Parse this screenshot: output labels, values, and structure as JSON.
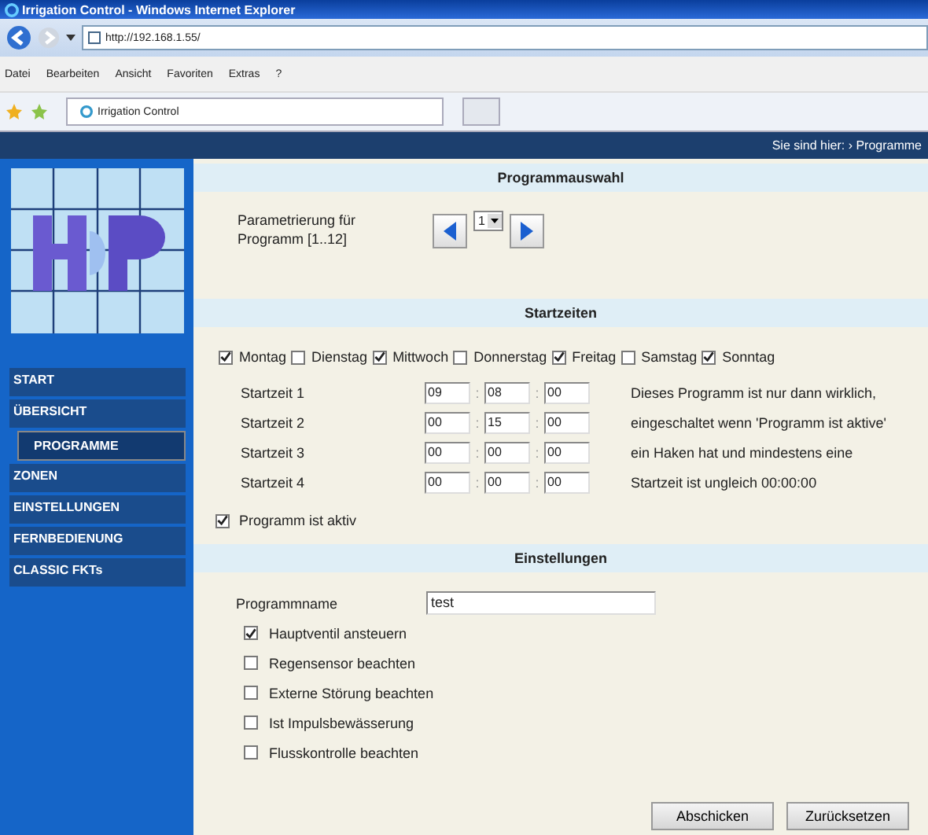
{
  "window": {
    "title": "Irrigation Control - Windows Internet Explorer"
  },
  "address_bar": {
    "url": "http://192.168.1.55/"
  },
  "menu": [
    "Datei",
    "Bearbeiten",
    "Ansicht",
    "Favoriten",
    "Extras",
    "?"
  ],
  "tab": {
    "label": "Irrigation Control"
  },
  "breadcrumb": {
    "label": "Sie sind hier:",
    "arrow": "›",
    "current": "Programme"
  },
  "sidebar": {
    "items": [
      {
        "label": "START",
        "selected": false,
        "sub": false
      },
      {
        "label": "ÜBERSICHT",
        "selected": false,
        "sub": false
      },
      {
        "label": "PROGRAMME",
        "selected": true,
        "sub": true
      },
      {
        "label": "ZONEN",
        "selected": false,
        "sub": false
      },
      {
        "label": "EINSTELLUNGEN",
        "selected": false,
        "sub": false
      },
      {
        "label": "FERNBEDIENUNG",
        "selected": false,
        "sub": false
      },
      {
        "label": "CLASSIC FKTs",
        "selected": false,
        "sub": false
      }
    ]
  },
  "program_selection": {
    "heading": "Programmauswahl",
    "label": "Parametrierung für Programm [1..12]",
    "value": "1"
  },
  "start_times": {
    "heading": "Startzeiten",
    "days": [
      {
        "label": "Montag",
        "checked": true
      },
      {
        "label": "Dienstag",
        "checked": false
      },
      {
        "label": "Mittwoch",
        "checked": true
      },
      {
        "label": "Donnerstag",
        "checked": false
      },
      {
        "label": "Freitag",
        "checked": true
      },
      {
        "label": "Samstag",
        "checked": false
      },
      {
        "label": "Sonntag",
        "checked": true
      }
    ],
    "rows": [
      {
        "label": "Startzeit 1",
        "h": "09",
        "m": "08",
        "s": "00",
        "note": "Dieses Programm ist nur dann wirklich,"
      },
      {
        "label": "Startzeit 2",
        "h": "00",
        "m": "15",
        "s": "00",
        "note": "eingeschaltet wenn 'Programm ist aktive'"
      },
      {
        "label": "Startzeit 3",
        "h": "00",
        "m": "00",
        "s": "00",
        "note": "ein Haken hat und mindestens eine"
      },
      {
        "label": "Startzeit 4",
        "h": "00",
        "m": "00",
        "s": "00",
        "note": "Startzeit ist ungleich 00:00:00"
      }
    ],
    "separator": ":",
    "active": {
      "label": "Programm ist aktiv",
      "checked": true
    }
  },
  "settings": {
    "heading": "Einstellungen",
    "name_label": "Programmname",
    "name_value": "test",
    "options": [
      {
        "label": "Hauptventil ansteuern",
        "checked": true
      },
      {
        "label": "Regensensor beachten",
        "checked": false
      },
      {
        "label": "Externe Störung beachten",
        "checked": false
      },
      {
        "label": "Ist Impulsbewässerung",
        "checked": false
      },
      {
        "label": "Flusskontrolle beachten",
        "checked": false
      }
    ]
  },
  "buttons": [
    "Abschicken",
    "Zurücksetzen"
  ]
}
